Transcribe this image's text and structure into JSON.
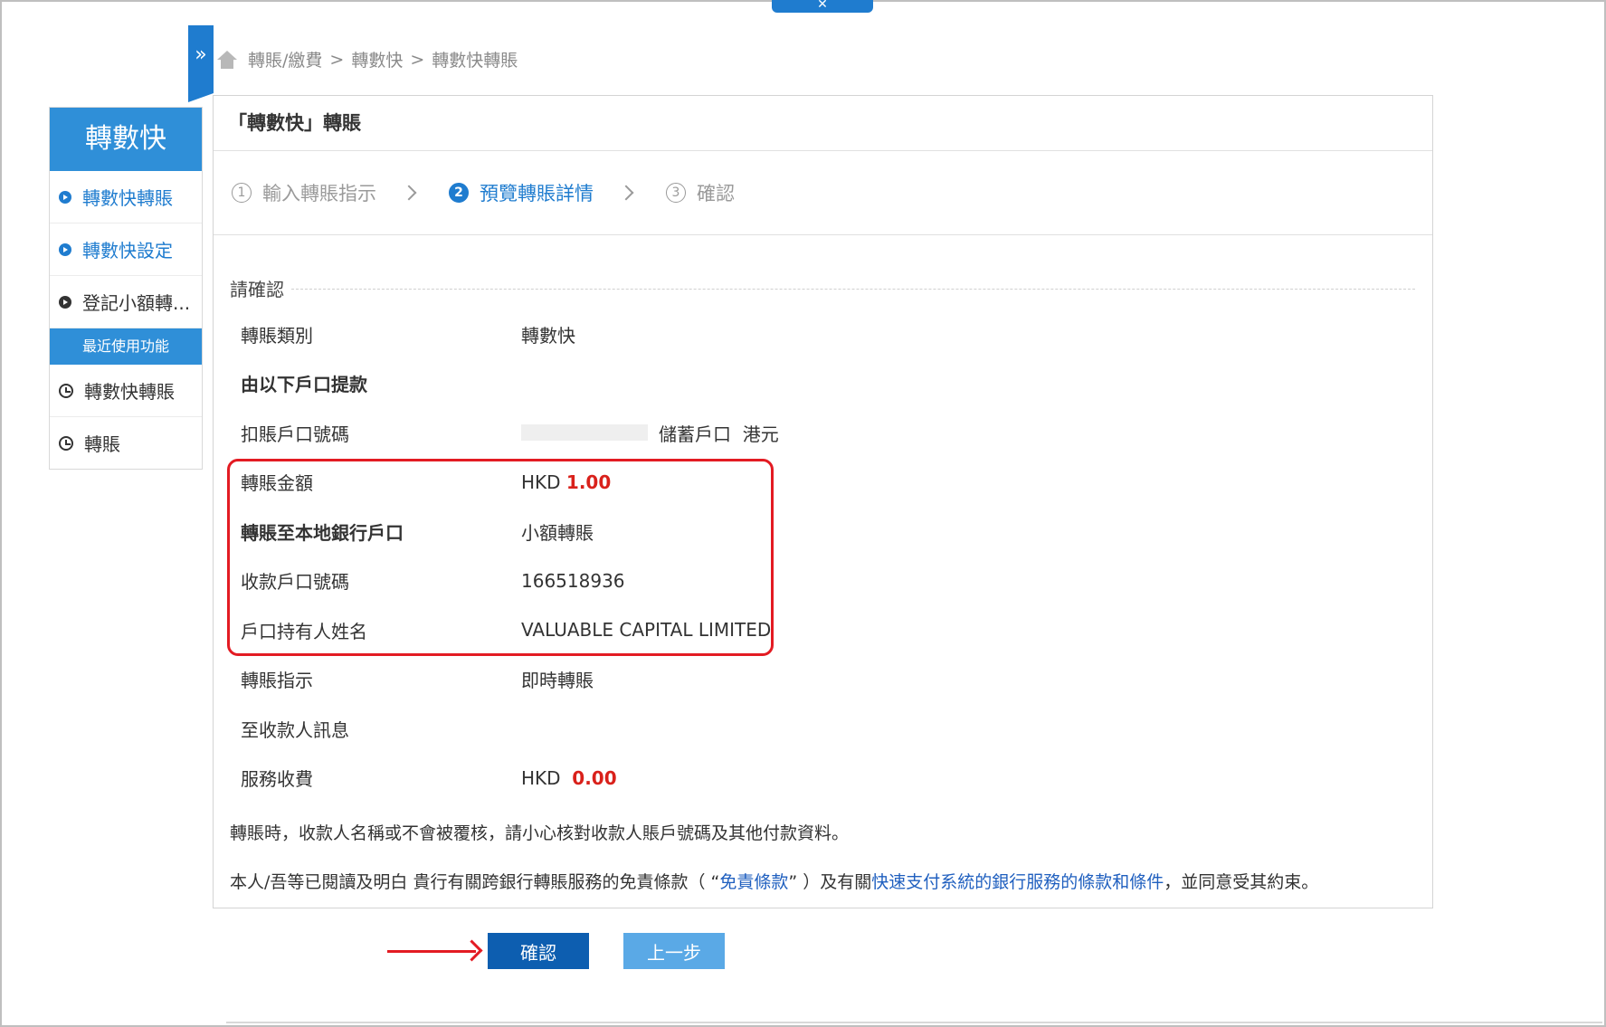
{
  "top_tab_label": "✕",
  "breadcrumb": [
    "轉賬/繳費",
    "轉數快",
    "轉數快轉賬"
  ],
  "breadcrumb_sep": ">",
  "sidebar": {
    "title": "轉數快",
    "items": [
      {
        "label": "轉數快轉賬"
      },
      {
        "label": "轉數快設定"
      },
      {
        "label": "登記小額轉..."
      }
    ],
    "recent_title": "最近使用功能",
    "recent_items": [
      {
        "label": "轉數快轉賬"
      },
      {
        "label": "轉賬"
      }
    ]
  },
  "panel": {
    "title": "「轉數快」轉賬",
    "steps": [
      {
        "num": "1",
        "label": "輸入轉賬指示"
      },
      {
        "num": "2",
        "label": "預覽轉賬詳情"
      },
      {
        "num": "3",
        "label": "確認"
      }
    ],
    "confirm_heading": "請確認",
    "rows": {
      "type_label": "轉賬類別",
      "type_value": "轉數快",
      "from_heading": "由以下戶口提款",
      "debit_label": "扣賬戶口號碼",
      "debit_type": "儲蓄戶口",
      "debit_currency": "港元",
      "amount_label": "轉賬金額",
      "amount_currency": "HKD",
      "amount_value": "1.00",
      "to_label": "轉賬至本地銀行戶口",
      "to_value": "小額轉賬",
      "payee_acct_label": "收款戶口號碼",
      "payee_acct_value": "166518936",
      "holder_label": "戶口持有人姓名",
      "holder_value": "VALUABLE CAPITAL LIMITED",
      "instruction_label": "轉賬指示",
      "instruction_value": "即時轉賬",
      "message_label": "至收款人訊息",
      "fee_label": "服務收費",
      "fee_currency": "HKD",
      "fee_value": "0.00"
    },
    "notice1": "轉賬時，收款人名稱或不會被覆核，請小心核對收款人賬戶號碼及其他付款資料。",
    "notice2_a": "本人/吾等已閱讀及明白 貴行有關跨銀行轉賬服務的免責條款（ “",
    "notice2_link1": "免責條款",
    "notice2_b": "” ）及有關",
    "notice2_link2": "快速支付系統的銀行服務的條款和條件",
    "notice2_c": "，並同意受其約束。"
  },
  "buttons": {
    "confirm": "確認",
    "back": "上一步"
  },
  "colors": {
    "primary": "#1f7ccf",
    "highlight": "#e31b23",
    "amount": "#d9211b"
  }
}
